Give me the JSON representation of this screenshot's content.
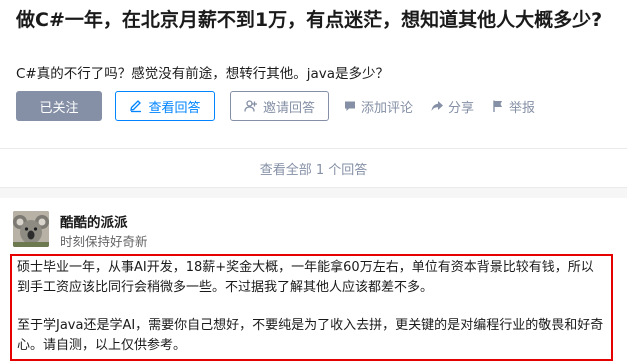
{
  "question": {
    "title": "做C#一年，在北京月薪不到1万，有点迷茫，想知道其他人大概多少?",
    "detail": "C#真的不行了吗？感觉没有前途，想转行其他。java是多少？"
  },
  "actions": {
    "followed_label": "已关注",
    "view_answers_label": "查看回答",
    "invite_label": "邀请回答",
    "comment_label": "添加评论",
    "share_label": "分享",
    "report_label": "举报"
  },
  "view_all": {
    "label": "查看全部 1 个回答"
  },
  "answer": {
    "author_name": "酷酷的派派",
    "author_bio": "时刻保持好奇新",
    "paragraphs": [
      "硕士毕业一年，从事AI开发，18薪+奖金大概，一年能拿60万左右，单位有资本背景比较有钱，所以到手工资应该比同行会稍微多一些。不过据我了解其他人应该都差不多。",
      "至于学Java还是学AI，需要你自己想好，不要纯是为了收入去拼，更关键的是对编程行业的敬畏和好奇心。请自测，以上仅供参考。"
    ]
  },
  "colors": {
    "brand_blue": "#0084ff",
    "muted_gray": "#8590a6",
    "highlight_border": "#e60000"
  },
  "icons": [
    "edit-icon",
    "invite-icon",
    "comment-icon",
    "share-icon",
    "flag-icon"
  ]
}
